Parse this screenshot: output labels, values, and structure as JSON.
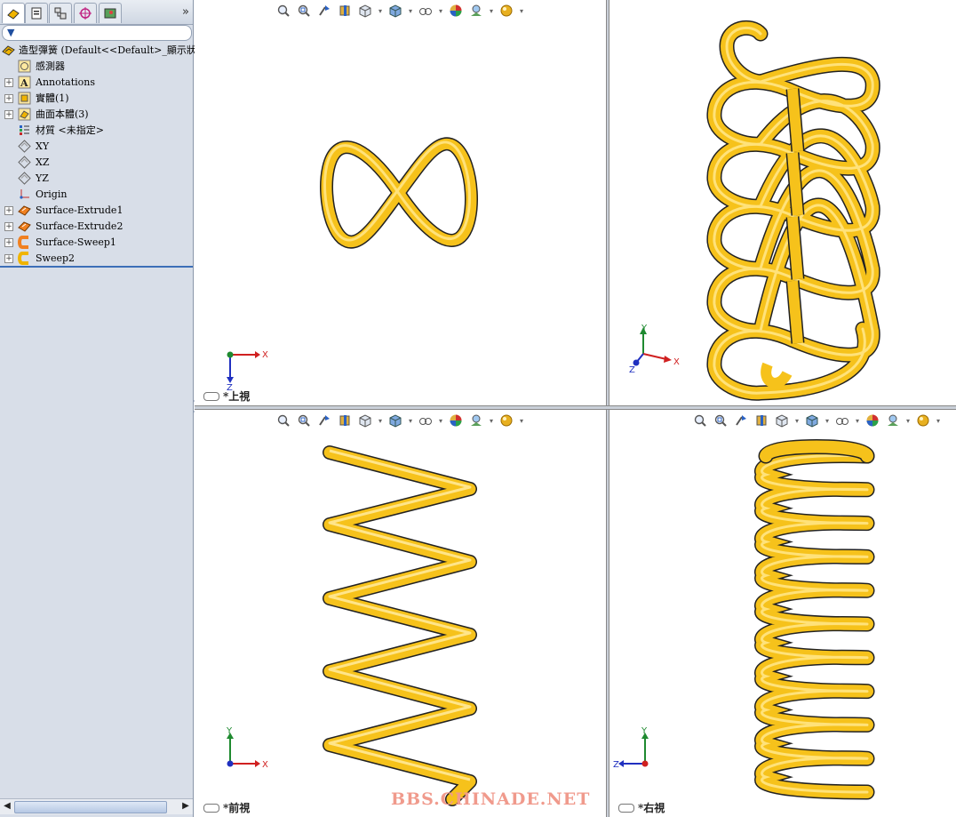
{
  "tree": {
    "root": "造型彈簧  (Default<<Default>_顯示狀態",
    "items": [
      {
        "label": "感測器",
        "icon": "sensor-icon",
        "expandable": false
      },
      {
        "label": "Annotations",
        "icon": "annotations-icon",
        "expandable": true
      },
      {
        "label": "實體(1)",
        "icon": "solid-bodies-icon",
        "expandable": true
      },
      {
        "label": "曲面本體(3)",
        "icon": "surface-bodies-icon",
        "expandable": true
      },
      {
        "label": "材質 <未指定>",
        "icon": "material-icon",
        "expandable": false
      },
      {
        "label": "XY",
        "icon": "plane-icon",
        "expandable": false
      },
      {
        "label": "XZ",
        "icon": "plane-icon",
        "expandable": false
      },
      {
        "label": "YZ",
        "icon": "plane-icon",
        "expandable": false
      },
      {
        "label": "Origin",
        "icon": "origin-icon",
        "expandable": false
      },
      {
        "label": "Surface-Extrude1",
        "icon": "surface-extrude-icon",
        "expandable": true
      },
      {
        "label": "Surface-Extrude2",
        "icon": "surface-extrude-icon",
        "expandable": true
      },
      {
        "label": "Surface-Sweep1",
        "icon": "surface-sweep-icon",
        "expandable": true
      },
      {
        "label": "Sweep2",
        "icon": "sweep-icon",
        "expandable": true
      }
    ]
  },
  "viewports": {
    "top": {
      "label": "*上視",
      "triad": [
        "X",
        "Z"
      ]
    },
    "iso": {
      "label": "",
      "triad": [
        "Y",
        "X",
        "Z"
      ]
    },
    "front": {
      "label": "*前視",
      "triad": [
        "Y",
        "X"
      ]
    },
    "right": {
      "label": "*右視",
      "triad": [
        "Y",
        "Z"
      ]
    }
  },
  "watermark": "BBS.CHINADE.NET",
  "colors": {
    "spring": "#f6c21b",
    "spring_dark": "#c58e00",
    "panel": "#d8dee8"
  }
}
